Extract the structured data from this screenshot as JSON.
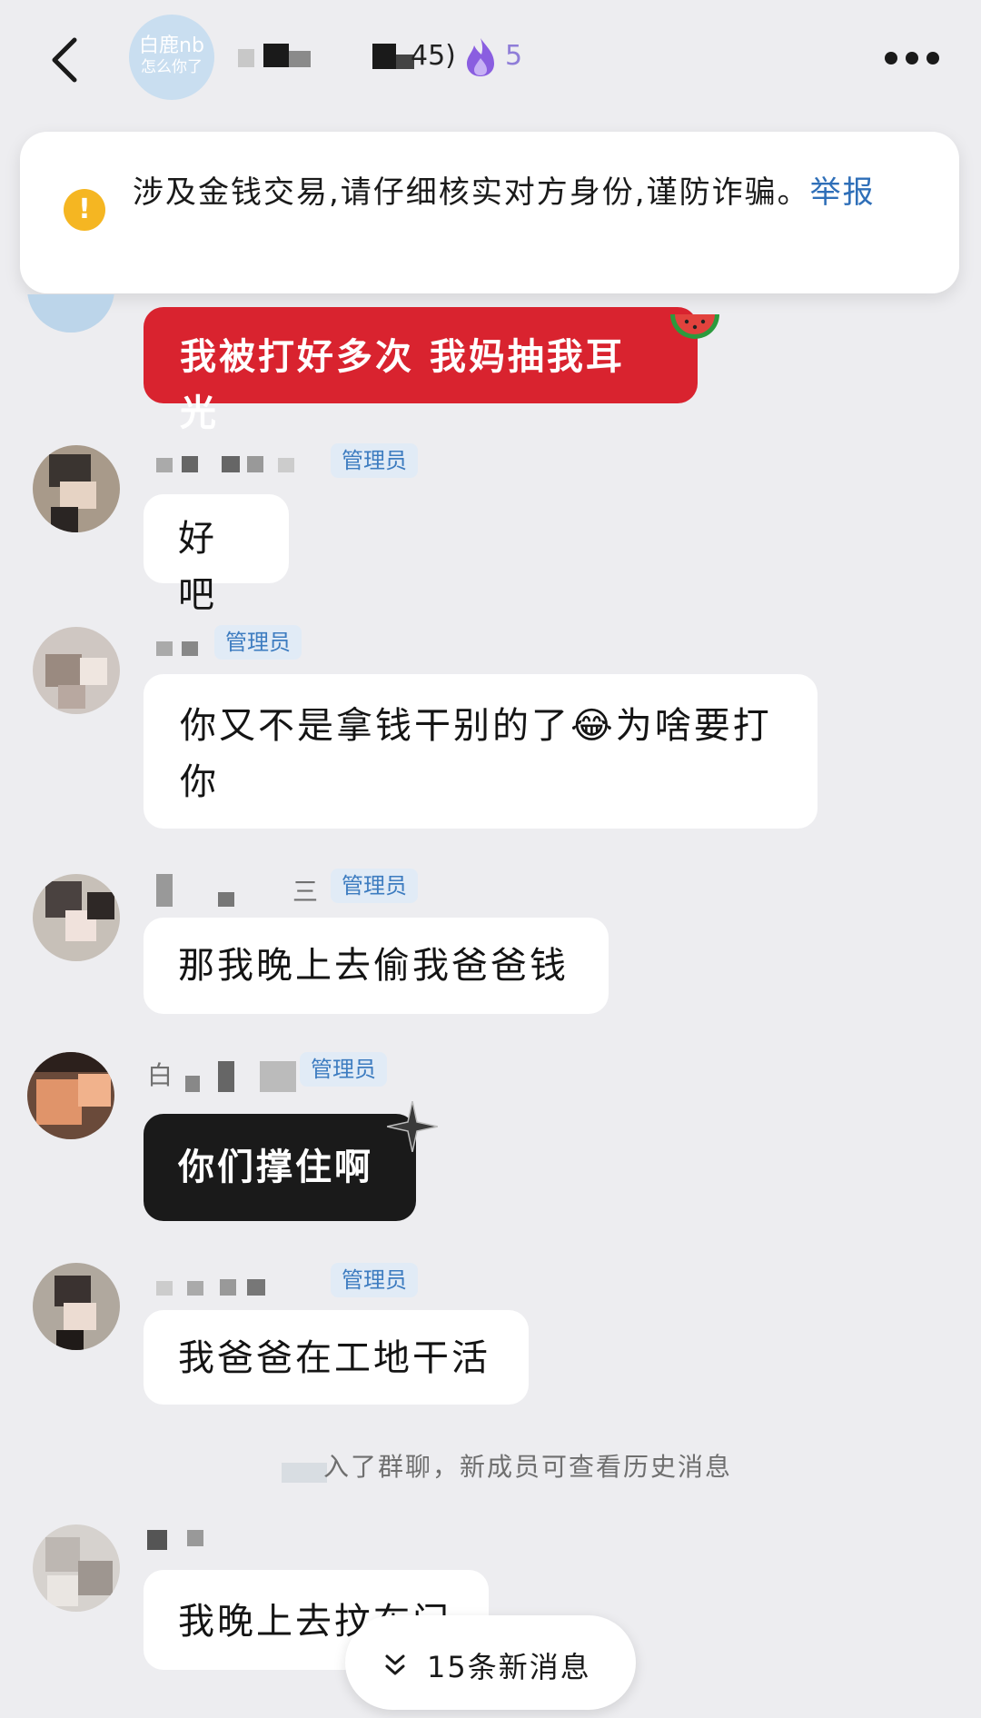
{
  "header": {
    "group_avatar_line1": "白鹿nb",
    "group_avatar_line2": "怎么你了",
    "member_count_fragment": "45)",
    "fire_count": "5"
  },
  "warning": {
    "text": "涉及金钱交易,请仔细核实对方身份,谨防诈骗。",
    "link": "举报"
  },
  "colors": {
    "warning_icon": "#f5b622",
    "admin_badge_bg": "#e1ebf6",
    "admin_badge_text": "#3d7cc0",
    "red_bubble": "#d9232f",
    "link": "#2f6fb8"
  },
  "messages": [
    {
      "text": "我被打好多次 我妈抽我耳光",
      "style": "red"
    },
    {
      "name": "",
      "badge": "管理员",
      "text": "好吧"
    },
    {
      "name": "",
      "badge": "管理员",
      "text": "你又不是拿钱干别的了",
      "emoji": "😂",
      "text_after": "为啥要打你"
    },
    {
      "name": "三",
      "badge": "管理员",
      "text": "那我晚上去偷我爸爸钱"
    },
    {
      "name": "白",
      "badge": "管理员",
      "text": "你们撑住啊",
      "style": "dark"
    },
    {
      "name": "",
      "badge": "管理员",
      "text": "我爸爸在工地干活"
    },
    {
      "name": "",
      "text": "我晚上去抆布门"
    }
  ],
  "system_notice": "入了群聊，新成员可查看历史消息",
  "new_messages_button": "15条新消息",
  "icons": [
    "back-arrow-icon",
    "flame-icon",
    "more-dots-icon",
    "warning-icon",
    "chevron-double-down-icon"
  ]
}
